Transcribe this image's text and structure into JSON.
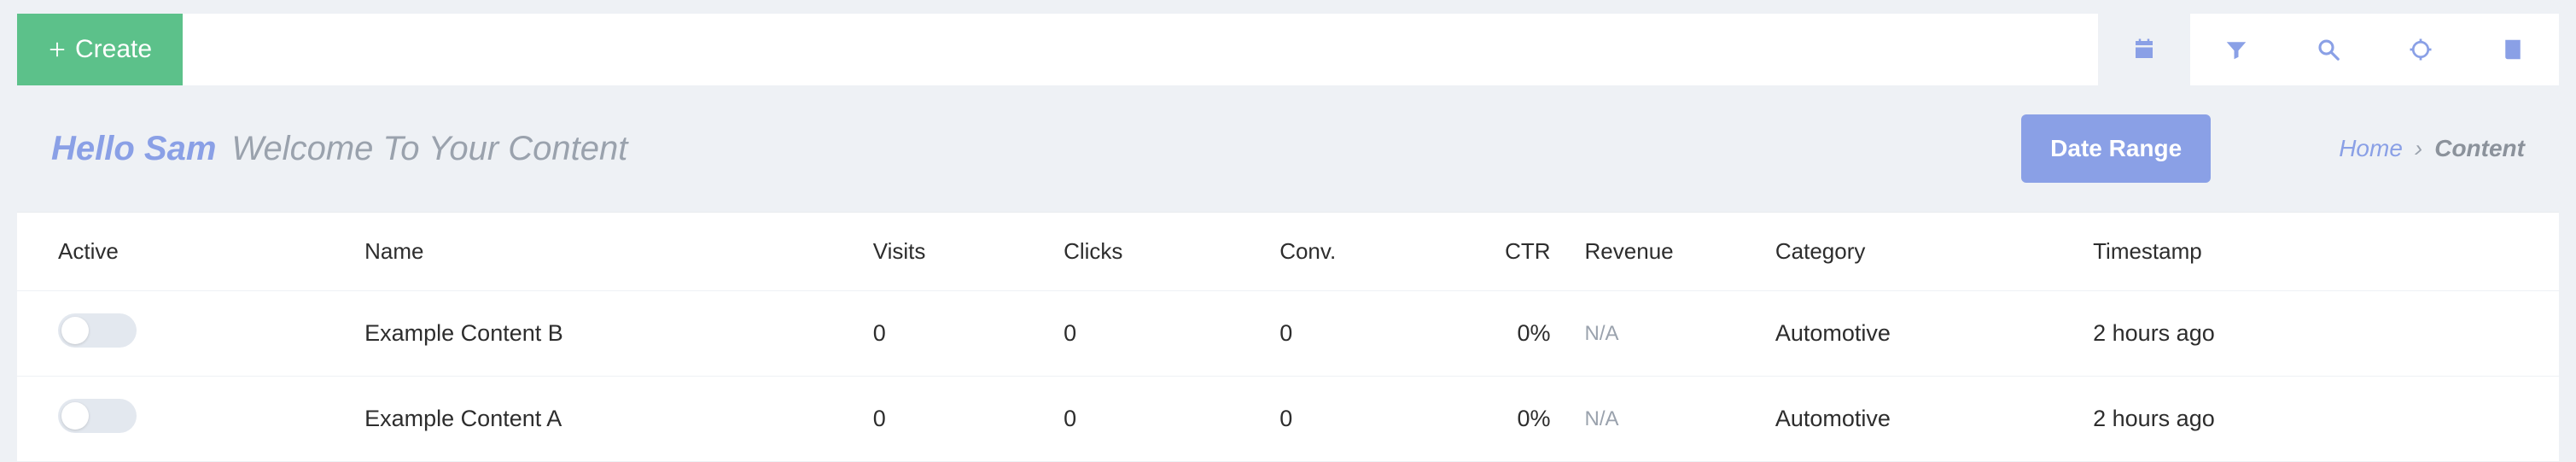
{
  "toolbar": {
    "create_label": "Create"
  },
  "greeting": {
    "hello": "Hello Sam",
    "welcome": "Welcome To Your Content",
    "date_range_label": "Date Range"
  },
  "breadcrumb": {
    "home": "Home",
    "sep": "›",
    "current": "Content"
  },
  "table": {
    "headers": {
      "active": "Active",
      "name": "Name",
      "visits": "Visits",
      "clicks": "Clicks",
      "conv": "Conv.",
      "ctr": "CTR",
      "revenue": "Revenue",
      "category": "Category",
      "timestamp": "Timestamp"
    },
    "rows": [
      {
        "active": false,
        "name": "Example Content B",
        "visits": "0",
        "clicks": "0",
        "conv": "0",
        "ctr": "0%",
        "revenue": "N/A",
        "category": "Automotive",
        "timestamp": "2 hours ago"
      },
      {
        "active": false,
        "name": "Example Content A",
        "visits": "0",
        "clicks": "0",
        "conv": "0",
        "ctr": "0%",
        "revenue": "N/A",
        "category": "Automotive",
        "timestamp": "2 hours ago"
      }
    ]
  }
}
